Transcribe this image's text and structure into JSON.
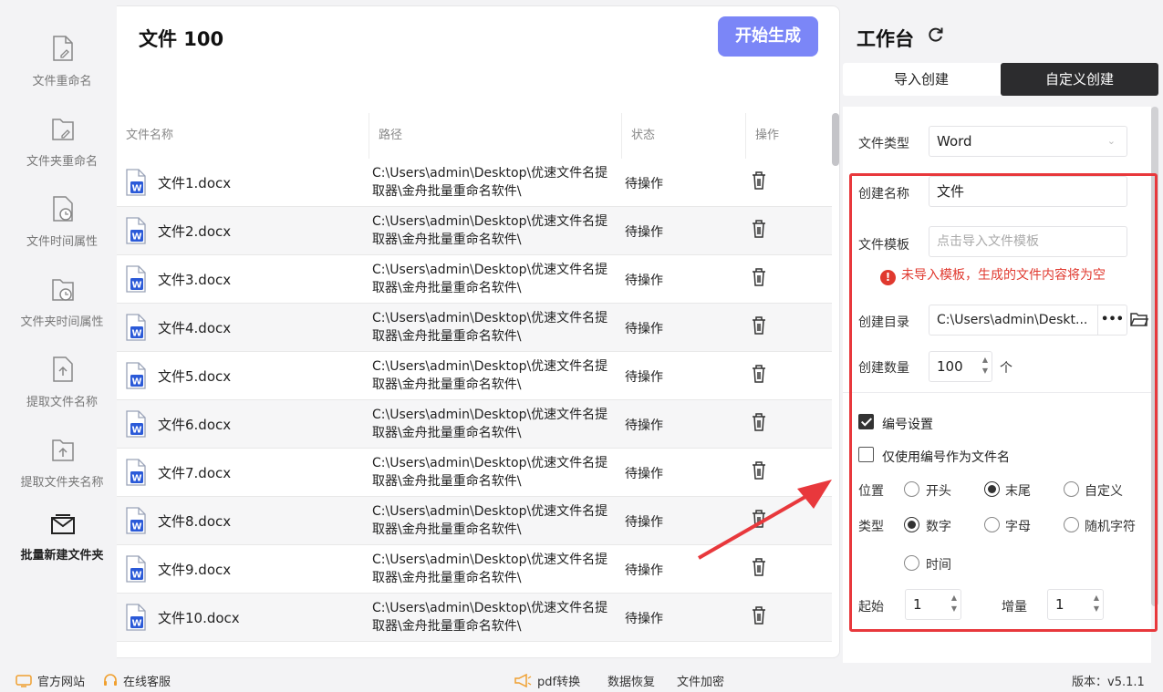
{
  "sidebar": {
    "items": [
      {
        "label": "文件重命名",
        "icon": "file-edit-icon"
      },
      {
        "label": "文件夹重命名",
        "icon": "folder-edit-icon"
      },
      {
        "label": "文件时间属性",
        "icon": "file-clock-icon"
      },
      {
        "label": "文件夹时间属性",
        "icon": "folder-clock-icon"
      },
      {
        "label": "提取文件名称",
        "icon": "file-upload-icon"
      },
      {
        "label": "提取文件夹名称",
        "icon": "folder-upload-icon"
      },
      {
        "label": "批量新建文件夹",
        "icon": "mail-folder-icon",
        "active": true
      }
    ]
  },
  "main": {
    "title": "文件 100",
    "generate_button": "开始生成",
    "columns": [
      "文件名称",
      "路径",
      "状态",
      "操作"
    ],
    "rows": [
      {
        "name": "文件1.docx",
        "path": "C:\\Users\\admin\\Desktop\\优速文件名提取器\\金舟批量重命名软件\\",
        "status": "待操作"
      },
      {
        "name": "文件2.docx",
        "path": "C:\\Users\\admin\\Desktop\\优速文件名提取器\\金舟批量重命名软件\\",
        "status": "待操作"
      },
      {
        "name": "文件3.docx",
        "path": "C:\\Users\\admin\\Desktop\\优速文件名提取器\\金舟批量重命名软件\\",
        "status": "待操作"
      },
      {
        "name": "文件4.docx",
        "path": "C:\\Users\\admin\\Desktop\\优速文件名提取器\\金舟批量重命名软件\\",
        "status": "待操作"
      },
      {
        "name": "文件5.docx",
        "path": "C:\\Users\\admin\\Desktop\\优速文件名提取器\\金舟批量重命名软件\\",
        "status": "待操作"
      },
      {
        "name": "文件6.docx",
        "path": "C:\\Users\\admin\\Desktop\\优速文件名提取器\\金舟批量重命名软件\\",
        "status": "待操作"
      },
      {
        "name": "文件7.docx",
        "path": "C:\\Users\\admin\\Desktop\\优速文件名提取器\\金舟批量重命名软件\\",
        "status": "待操作"
      },
      {
        "name": "文件8.docx",
        "path": "C:\\Users\\admin\\Desktop\\优速文件名提取器\\金舟批量重命名软件\\",
        "status": "待操作"
      },
      {
        "name": "文件9.docx",
        "path": "C:\\Users\\admin\\Desktop\\优速文件名提取器\\金舟批量重命名软件\\",
        "status": "待操作"
      },
      {
        "name": "文件10.docx",
        "path": "C:\\Users\\admin\\Desktop\\优速文件名提取器\\金舟批量重命名软件\\",
        "status": "待操作"
      }
    ]
  },
  "workspace": {
    "title": "工作台",
    "tabs": [
      {
        "label": "导入创建",
        "active": false
      },
      {
        "label": "自定义创建",
        "active": true
      }
    ],
    "file_type_label": "文件类型",
    "file_type_value": "Word",
    "create_name_label": "创建名称",
    "create_name_value": "文件",
    "template_label": "文件模板",
    "template_placeholder": "点击导入文件模板",
    "template_warning": "未导入模板，生成的文件内容将为空",
    "dir_label": "创建目录",
    "dir_value": "C:\\Users\\admin\\Deskt...",
    "dir_more": "•••",
    "count_label": "创建数量",
    "count_value": "100",
    "count_unit": "个",
    "numbering_label": "编号设置",
    "numbering_checked": true,
    "only_number_label": "仅使用编号作为文件名",
    "only_number_checked": false,
    "position_label": "位置",
    "position_options": [
      "开头",
      "末尾",
      "自定义"
    ],
    "position_selected": "末尾",
    "type_label": "类型",
    "type_options": [
      "数字",
      "字母",
      "随机字符",
      "时间"
    ],
    "type_selected": "数字",
    "start_label": "起始",
    "start_value": "1",
    "step_label": "增量",
    "step_value": "1"
  },
  "footer": {
    "website": "官方网站",
    "support": "在线客服",
    "pdf": "pdf转换",
    "recovery": "数据恢复",
    "encrypt": "文件加密",
    "version": "版本：v5.1.1"
  },
  "colors": {
    "accent": "#7b86f7",
    "active_tab": "#2c2c2e",
    "warning": "#e0392f",
    "highlight": "#e8383c",
    "word_blue": "#2b5ad8"
  }
}
